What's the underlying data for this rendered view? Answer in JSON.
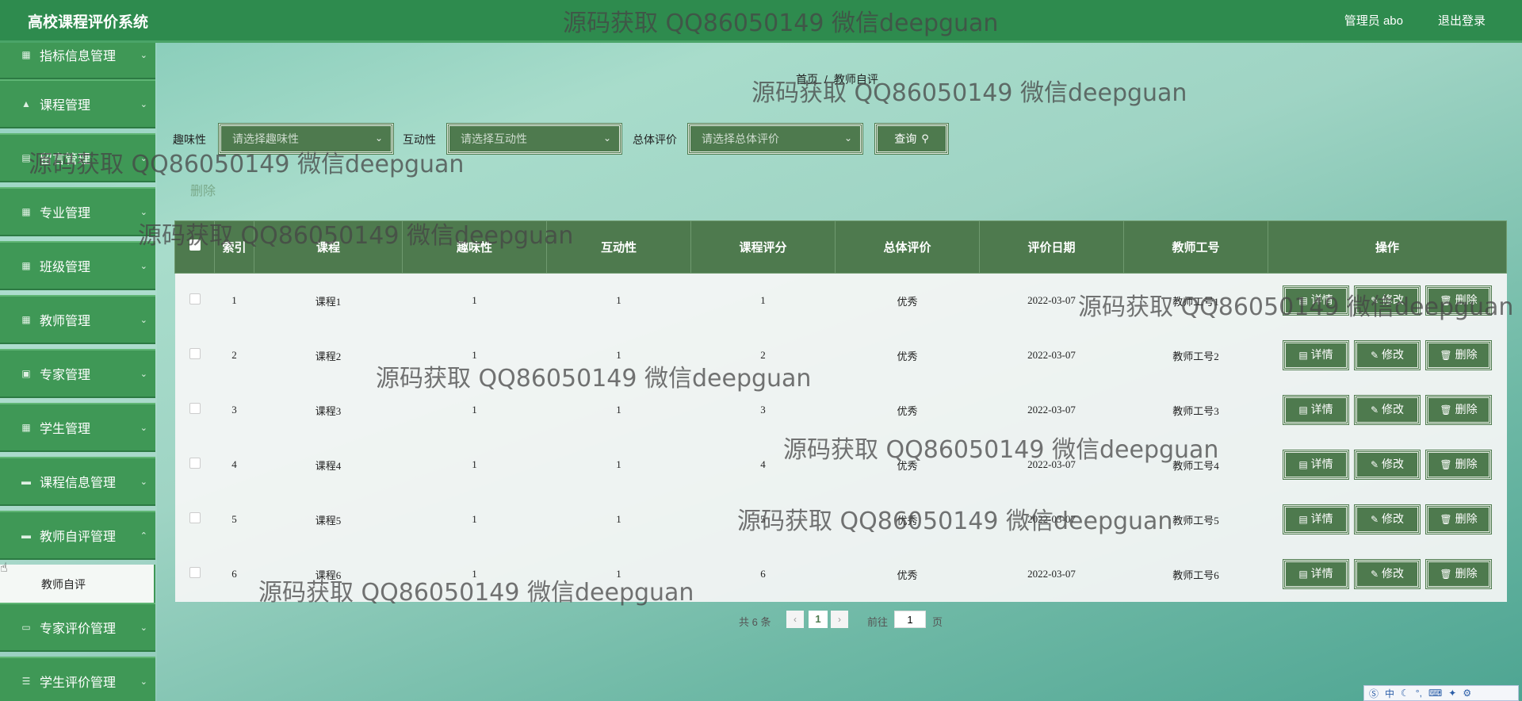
{
  "app": {
    "title": "高校课程评价系统"
  },
  "header": {
    "user": "管理员 abo",
    "logout": "退出登录"
  },
  "sidebar": {
    "items": [
      {
        "label": "指标信息管理",
        "icon": "grid-icon"
      },
      {
        "label": "课程管理",
        "icon": "thumb-icon"
      },
      {
        "label": "留言管理",
        "icon": "doc-icon"
      },
      {
        "label": "专业管理",
        "icon": "grid-icon"
      },
      {
        "label": "班级管理",
        "icon": "grid-icon"
      },
      {
        "label": "教师管理",
        "icon": "grid-icon"
      },
      {
        "label": "专家管理",
        "icon": "clipboard-icon"
      },
      {
        "label": "学生管理",
        "icon": "grid-icon"
      },
      {
        "label": "课程信息管理",
        "icon": "monitor-icon"
      },
      {
        "label": "教师自评管理",
        "icon": "monitor-icon"
      },
      {
        "label": "专家评价管理",
        "icon": "chat-icon"
      },
      {
        "label": "学生评价管理",
        "icon": "list-icon"
      }
    ],
    "active_sub": "教师自评"
  },
  "breadcrumb": {
    "home": "首页",
    "sep": "/",
    "current": "教师自评"
  },
  "filters": {
    "interest_label": "趣味性",
    "interest_placeholder": "请选择趣味性",
    "interaction_label": "互动性",
    "interaction_placeholder": "请选择互动性",
    "overall_label": "总体评价",
    "overall_placeholder": "请选择总体评价",
    "query_button": "查询"
  },
  "delete_link": "删除",
  "table": {
    "headers": [
      "",
      "索引",
      "课程",
      "趣味性",
      "互动性",
      "课程评分",
      "总体评价",
      "评价日期",
      "教师工号",
      "操作"
    ],
    "rows": [
      {
        "index": "1",
        "course": "课程1",
        "interest": "1",
        "interaction": "1",
        "score": "1",
        "overall": "优秀",
        "date": "2022-03-07",
        "teacher_id": "教师工号1"
      },
      {
        "index": "2",
        "course": "课程2",
        "interest": "1",
        "interaction": "1",
        "score": "2",
        "overall": "优秀",
        "date": "2022-03-07",
        "teacher_id": "教师工号2"
      },
      {
        "index": "3",
        "course": "课程3",
        "interest": "1",
        "interaction": "1",
        "score": "3",
        "overall": "优秀",
        "date": "2022-03-07",
        "teacher_id": "教师工号3"
      },
      {
        "index": "4",
        "course": "课程4",
        "interest": "1",
        "interaction": "1",
        "score": "4",
        "overall": "优秀",
        "date": "2022-03-07",
        "teacher_id": "教师工号4"
      },
      {
        "index": "5",
        "course": "课程5",
        "interest": "1",
        "interaction": "1",
        "score": "5",
        "overall": "优秀",
        "date": "2022-03-07",
        "teacher_id": "教师工号5"
      },
      {
        "index": "6",
        "course": "课程6",
        "interest": "1",
        "interaction": "1",
        "score": "6",
        "overall": "优秀",
        "date": "2022-03-07",
        "teacher_id": "教师工号6"
      }
    ],
    "actions": {
      "detail": "详情",
      "edit": "修改",
      "delete": "删除"
    }
  },
  "pagination": {
    "total": "共 6 条",
    "current_page": "1",
    "goto_label": "前往",
    "goto_value": "1",
    "page_suffix": "页"
  },
  "watermark_text": "源码获取 QQ86050149 微信deepguan",
  "ime": {
    "mode": "中"
  }
}
